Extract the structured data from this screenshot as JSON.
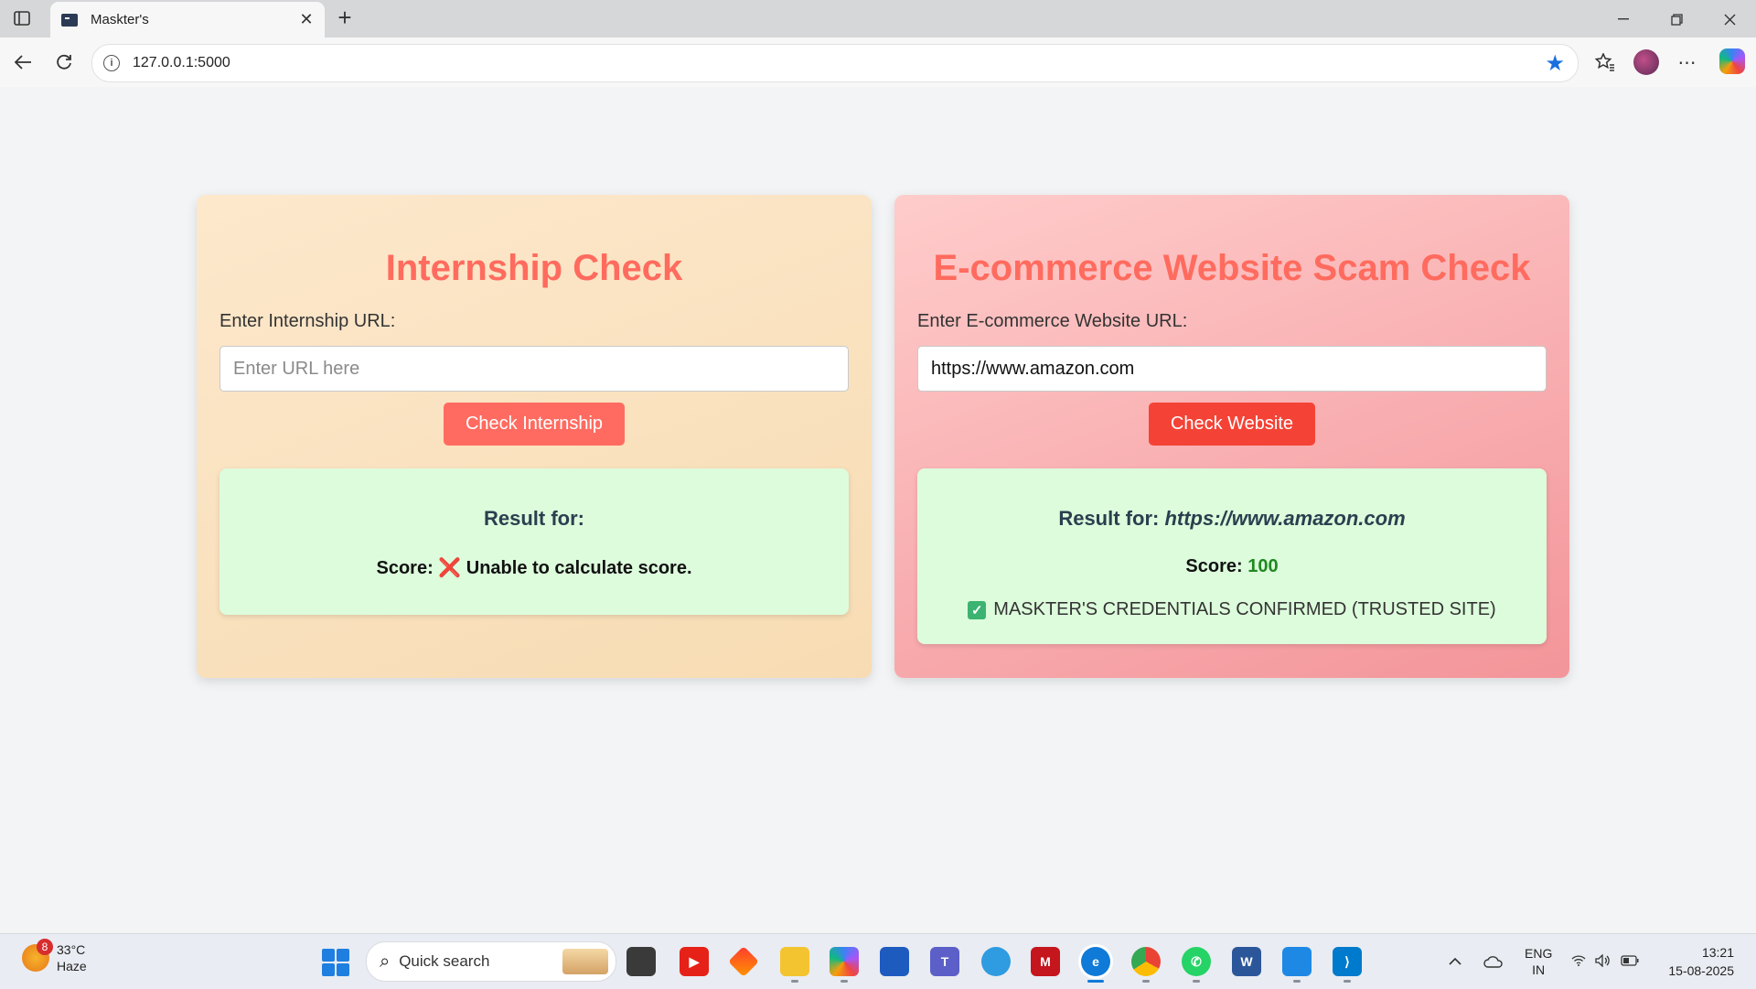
{
  "browser": {
    "tab_title": "Maskter's",
    "url": "127.0.0.1:5000",
    "new_tab_label": "+",
    "close_tab_label": "✕"
  },
  "internship": {
    "title": "Internship Check",
    "label": "Enter Internship URL:",
    "input_value": "",
    "input_placeholder": "Enter URL here",
    "button_label": "Check Internship",
    "result_for_label": "Result for:",
    "result_for_value": "",
    "score_label": "Score:",
    "score_value": "❌ Unable to calculate score."
  },
  "ecommerce": {
    "title": "E-commerce Website Scam Check",
    "label": "Enter E-commerce Website URL:",
    "input_value": "https://www.amazon.com",
    "input_placeholder": "",
    "button_label": "Check Website",
    "result_for_label": "Result for:",
    "result_for_value": "https://www.amazon.com",
    "score_label": "Score:",
    "score_value": "100",
    "credentials_text": "MASKTER'S CREDENTIALS CONFIRMED (TRUSTED SITE)"
  },
  "taskbar": {
    "weather_temp": "33°C",
    "weather_cond": "Haze",
    "weather_badge": "8",
    "search_placeholder": "Quick search",
    "lang_top": "ENG",
    "lang_bottom": "IN",
    "time": "13:21",
    "date": "15-08-2025"
  },
  "colors": {
    "title_accent": "#ff6b5e",
    "internship_button": "#ff6b60",
    "website_button": "#f44336",
    "result_bg": "#ddfcdc",
    "score_good": "#1f8a1f"
  }
}
